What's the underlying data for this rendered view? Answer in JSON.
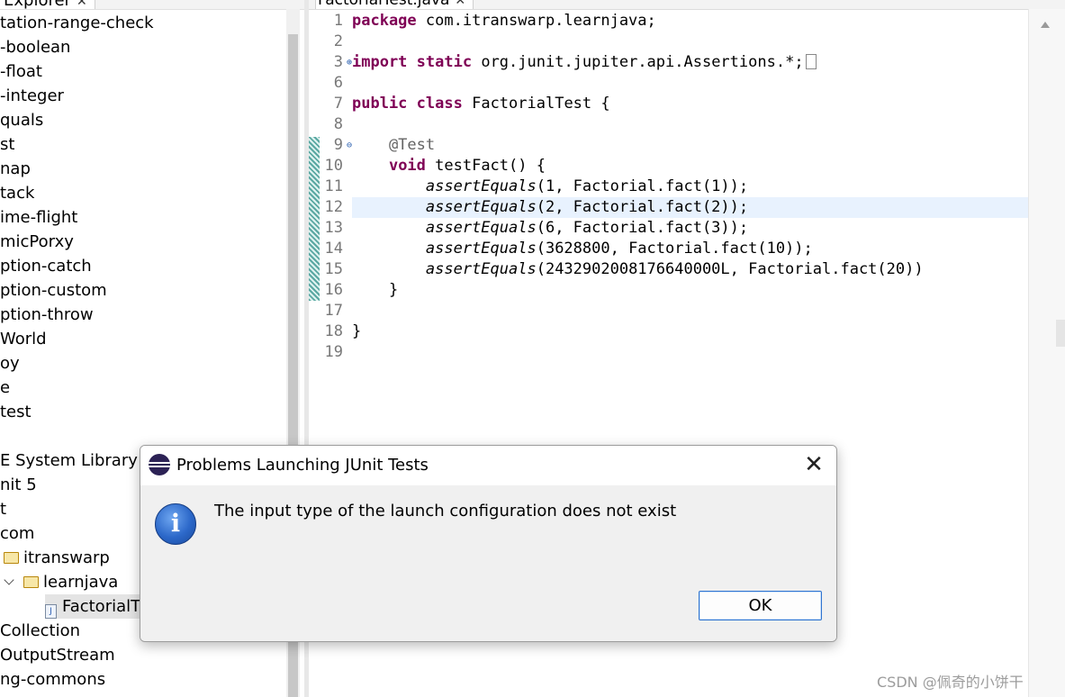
{
  "explorer": {
    "tab_label": "Explorer",
    "items": [
      {
        "label": "tation-range-check"
      },
      {
        "label": "-boolean"
      },
      {
        "label": "-float"
      },
      {
        "label": "-integer"
      },
      {
        "label": "quals"
      },
      {
        "label": "st"
      },
      {
        "label": "nap"
      },
      {
        "label": "tack"
      },
      {
        "label": "ime-flight"
      },
      {
        "label": "micPorxy"
      },
      {
        "label": "ption-catch"
      },
      {
        "label": "ption-custom"
      },
      {
        "label": "ption-throw"
      },
      {
        "label": "World"
      },
      {
        "label": "oy"
      },
      {
        "label": "e"
      },
      {
        "label": "test"
      },
      {
        "label": "E System Library [j"
      },
      {
        "label": "nit 5"
      },
      {
        "label": "t"
      },
      {
        "label": "com"
      },
      {
        "label": "itranswarp",
        "icon": "folder-icon"
      },
      {
        "label": "learnjava",
        "icon": "folder-icon",
        "expanded": true
      },
      {
        "label": "FactorialT",
        "icon": "java-file-icon",
        "selected": true
      },
      {
        "label": "Collection"
      },
      {
        "label": "OutputStream"
      },
      {
        "label": "ng-commons"
      }
    ]
  },
  "editor": {
    "tab_label": "FactorialTest.java",
    "current_line": 12,
    "line_numbers": [
      "1",
      "2",
      "3",
      "6",
      "7",
      "8",
      "9",
      "10",
      "11",
      "12",
      "13",
      "14",
      "15",
      "16",
      "17",
      "18",
      "19"
    ],
    "code": {
      "l1_kw": "package",
      "l1_rest": " com.itranswarp.learnjava;",
      "l3_kw1": "import",
      "l3_kw2": "static",
      "l3_rest": " org.junit.jupiter.api.Assertions.*;",
      "l7_kw1": "public",
      "l7_kw2": "class",
      "l7_rest": " FactorialTest {",
      "l9_ann": "    @Test",
      "l10_indent": "    ",
      "l10_kw": "void",
      "l10_rest": " testFact() {",
      "assert_indent": "        ",
      "assert_name": "assertEquals",
      "l11_args": "(1, Factorial.fact(1));",
      "l12_args": "(2, Factorial.fact(2));",
      "l13_args": "(6, Factorial.fact(3));",
      "l14_args": "(3628800, Factorial.fact(10));",
      "l15_args": "(2432902008176640000L, Factorial.fact(20))",
      "l16": "    }",
      "l18": "}"
    }
  },
  "dialog": {
    "title": "Problems Launching JUnit Tests",
    "close_symbol": "✕",
    "icon_glyph": "i",
    "message": "The input type of the launch configuration does not exist",
    "ok_label": "OK"
  },
  "watermark": "CSDN @佩奇的小饼干"
}
